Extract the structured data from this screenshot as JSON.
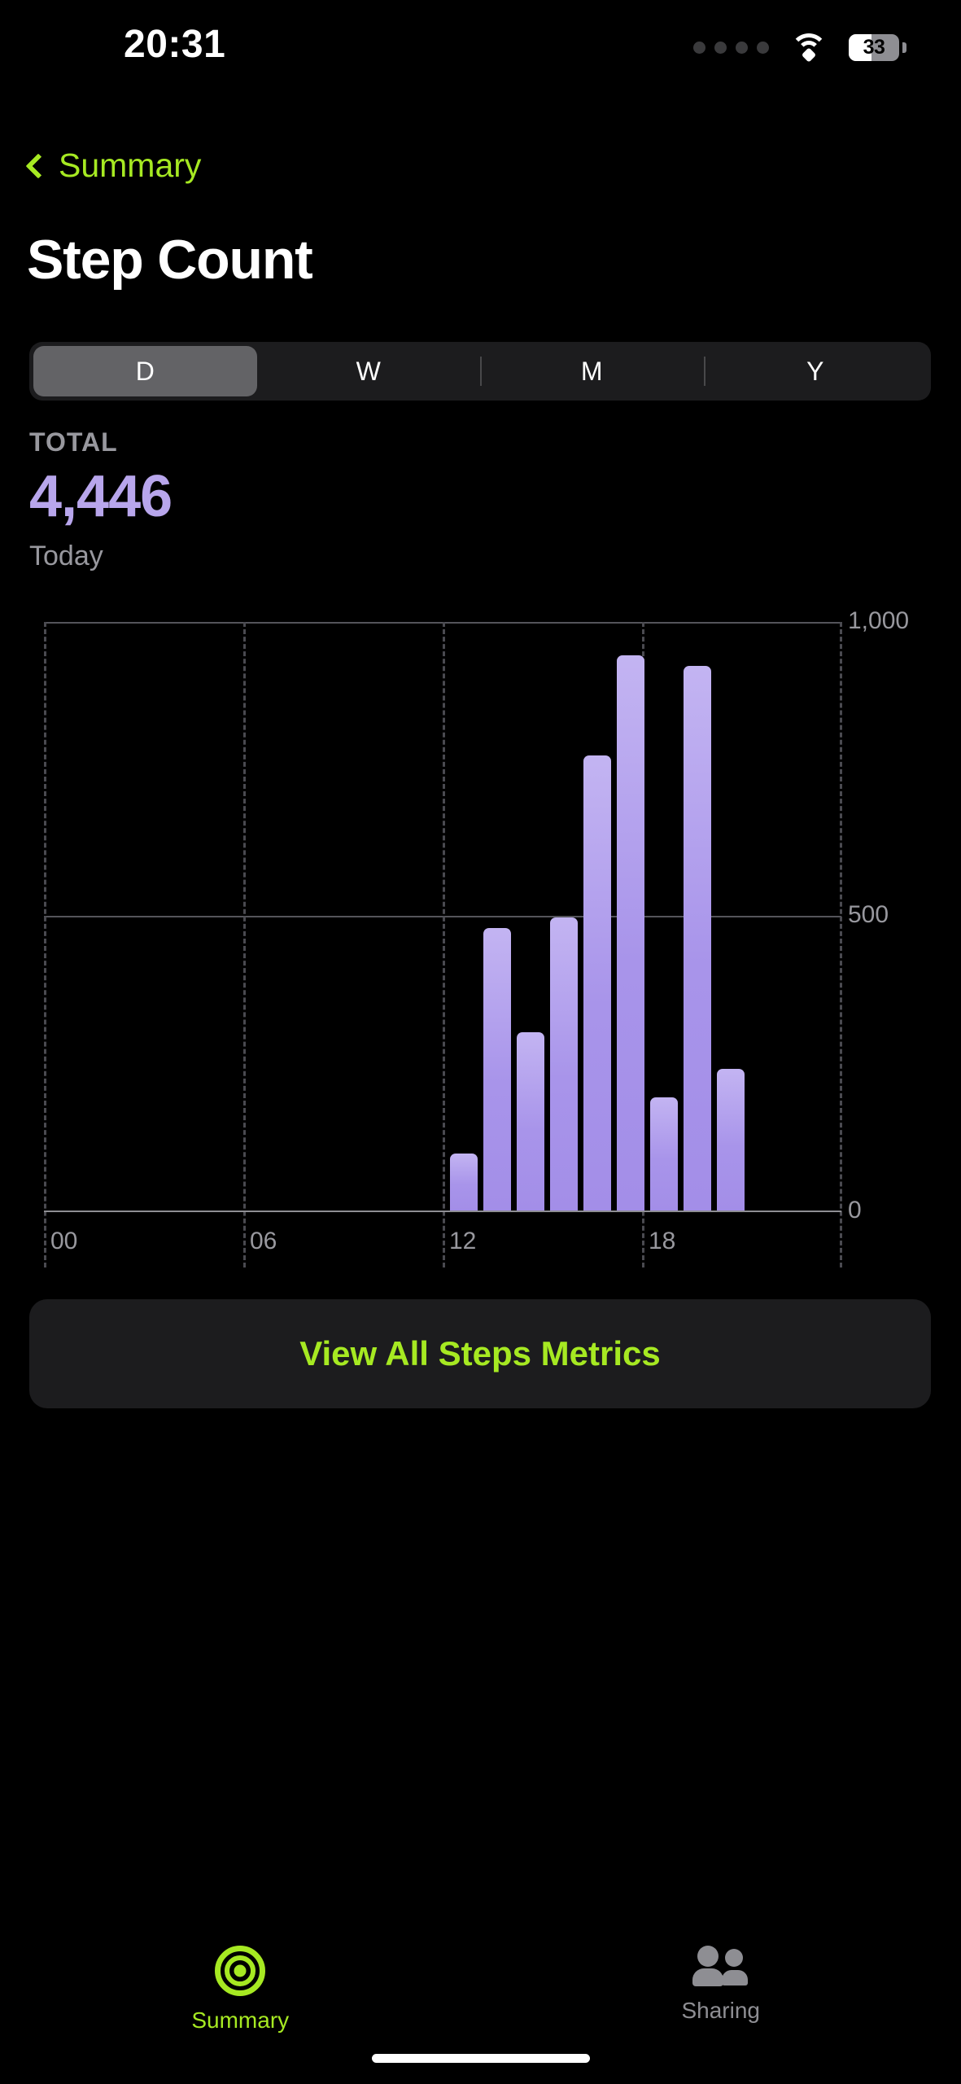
{
  "status_bar": {
    "time": "20:31",
    "signal_icon": "cellular-dots-icon",
    "wifi_icon": "wifi-icon",
    "battery_icon": "battery-icon",
    "battery_percent": "33",
    "battery_fill_ratio": 0.45
  },
  "nav": {
    "back_icon": "chevron-left-icon",
    "back_label": "Summary",
    "title": "Step Count"
  },
  "segmented_control": {
    "options": [
      {
        "label": "D",
        "selected": true
      },
      {
        "label": "W",
        "selected": false
      },
      {
        "label": "M",
        "selected": false
      },
      {
        "label": "Y",
        "selected": false
      }
    ]
  },
  "summary": {
    "total_label": "TOTAL",
    "total_value": "4,446",
    "subtitle": "Today"
  },
  "chart_data": {
    "type": "bar",
    "title": "Step Count",
    "xlabel": "",
    "ylabel": "",
    "ylim": [
      0,
      1000
    ],
    "yticks": [
      0,
      500,
      1000
    ],
    "ytick_labels": [
      "0",
      "500",
      "1,000"
    ],
    "xlim": [
      0,
      24
    ],
    "xticks": [
      0,
      6,
      12,
      18
    ],
    "xtick_labels": [
      "00",
      "06",
      "12",
      "18"
    ],
    "grid": "dashed-vertical-solid-horizontal",
    "legend": "none",
    "bar_color": "#a894ea",
    "units": "steps per hour",
    "categories": [
      "12",
      "13",
      "14",
      "15",
      "16",
      "17",
      "18",
      "19",
      "20"
    ],
    "values": [
      97,
      480,
      303,
      498,
      773,
      943,
      192,
      925,
      241
    ],
    "total": 4446
  },
  "cta": {
    "label": "View All Steps Metrics"
  },
  "tab_bar": {
    "tabs": [
      {
        "label": "Summary",
        "icon": "summary-rings-icon",
        "active": true
      },
      {
        "label": "Sharing",
        "icon": "people-sharing-icon",
        "active": false
      }
    ]
  },
  "colors": {
    "accent_green": "#a6e922",
    "data_purple": "#a894ea",
    "total_purple": "#b8a6ec",
    "background": "#000000",
    "card": "#1c1c1e",
    "secondary_text": "#98989e"
  }
}
